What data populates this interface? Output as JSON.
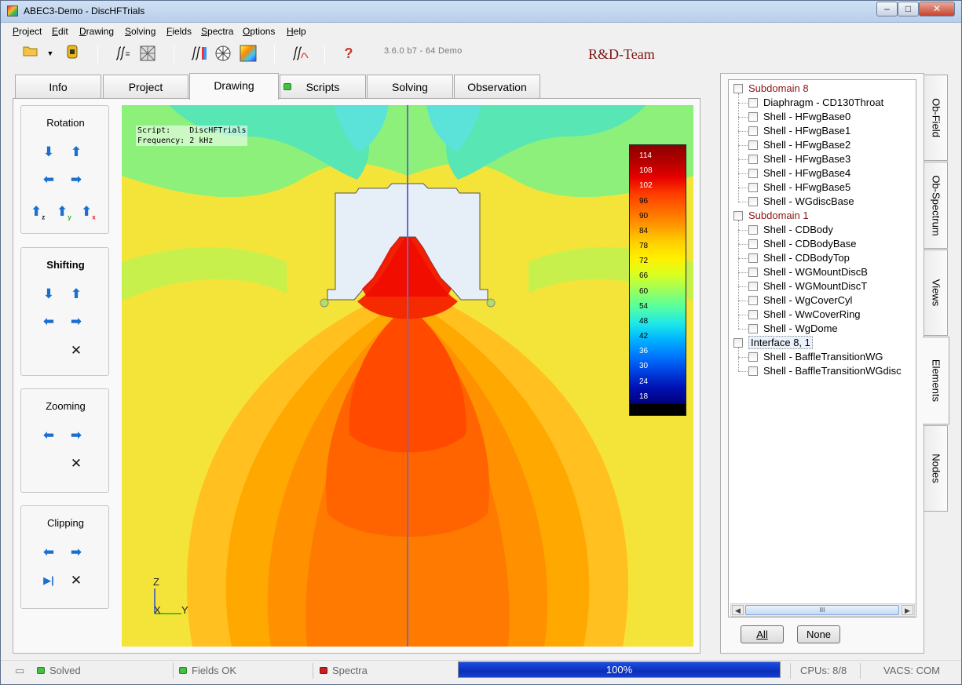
{
  "window": {
    "title": "ABEC3-Demo - DiscHFTrials",
    "min": "–",
    "max": "□",
    "close": "✕"
  },
  "menu": [
    "Project",
    "Edit",
    "Drawing",
    "Solving",
    "Fields",
    "Spectra",
    "Options",
    "Help"
  ],
  "menu_mnemonics": [
    "P",
    "E",
    "D",
    "S",
    "F",
    "S",
    "O",
    "H"
  ],
  "toolbar": {
    "version": "3.6.0 b7 - 64 Demo",
    "brand": "R&D-Team",
    "help_glyph": "?"
  },
  "tabs": [
    "Info",
    "Project",
    "Drawing",
    "Scripts",
    "Solving",
    "Observation"
  ],
  "active_tab": "Drawing",
  "controls": {
    "rotation": "Rotation",
    "shifting": "Shifting",
    "zooming": "Zooming",
    "clipping": "Clipping",
    "axis_z": "z",
    "axis_y": "y",
    "axis_x": "x"
  },
  "viewport": {
    "script_line": "Script:    DiscHFTrials",
    "frequency_line": "Frequency: 2 kHz",
    "axis_z": "Z",
    "axis_x": "X",
    "axis_y": "Y"
  },
  "colorbar": {
    "labels": [
      "114",
      "108",
      "102",
      "96",
      "90",
      "84",
      "78",
      "72",
      "66",
      "60",
      "54",
      "48",
      "42",
      "36",
      "30",
      "24",
      "18"
    ],
    "colors": [
      "#8b0000",
      "#b40000",
      "#e60000",
      "#ff3c00",
      "#ff6a00",
      "#ff9a00",
      "#ffd000",
      "#fff000",
      "#d9ff20",
      "#98ff60",
      "#55ffa0",
      "#1ee8e8",
      "#00b4ff",
      "#0078ff",
      "#0040e0",
      "#0010b0",
      "#00007a"
    ]
  },
  "tree": {
    "groups": [
      {
        "label": "Subdomain 8",
        "items": [
          "Diaphragm - CD130Throat",
          "Shell - HFwgBase0",
          "Shell - HFwgBase1",
          "Shell - HFwgBase2",
          "Shell - HFwgBase3",
          "Shell - HFwgBase4",
          "Shell - HFwgBase5",
          "Shell - WGdiscBase"
        ]
      },
      {
        "label": "Subdomain 1",
        "items": [
          "Shell - CDBody",
          "Shell - CDBodyBase",
          "Shell - CDBodyTop",
          "Shell - WGMountDiscB",
          "Shell - WGMountDiscT",
          "Shell - WgCoverCyl",
          "Shell - WwCoverRing",
          "Shell - WgDome"
        ]
      },
      {
        "label": "Interface 8, 1",
        "items": [
          "Shell - BaffleTransitionWG",
          "Shell - BaffleTransitionWGdisc"
        ]
      }
    ],
    "scroll_thumb": "III",
    "scroll_left": "◀",
    "scroll_right": "▶"
  },
  "tree_buttons": {
    "all": "All",
    "none": "None"
  },
  "side_tabs": [
    "Ob-Field",
    "Ob-Spectrum",
    "Views",
    "Elements",
    "Nodes"
  ],
  "active_side_tab": "Elements",
  "status": {
    "solved": "Solved",
    "fields": "Fields OK",
    "spectra": "Spectra",
    "progress": "100%",
    "progress_value": 1.0,
    "cpus": "CPUs: 8/8",
    "vacs": "VACS: COM",
    "colors": {
      "ok": "#3ec43e",
      "spectra": "#c81e1e"
    }
  }
}
